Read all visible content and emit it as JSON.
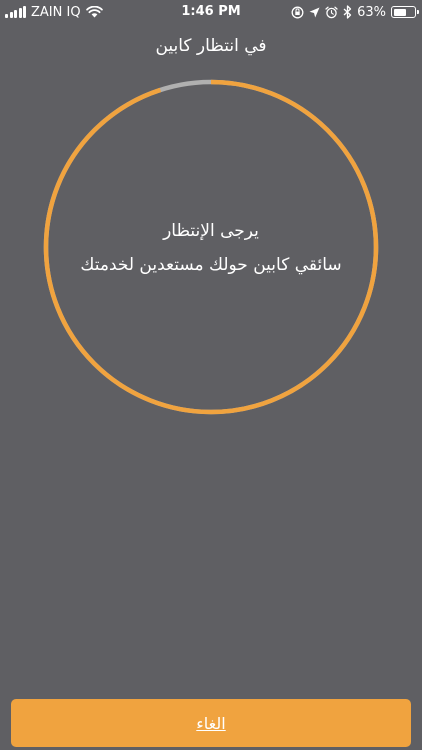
{
  "status_bar": {
    "carrier": "ZAIN IQ",
    "time": "1:46 PM",
    "battery_percent": "63%",
    "battery_level": 0.63
  },
  "header": {
    "title": "في انتظار كابين"
  },
  "waiting": {
    "title": "يرجى الإنتظار",
    "message": "سائقي كابين حولك مستعدين لخدمتك",
    "progress": 0.95
  },
  "footer": {
    "cancel_label": "الغاء"
  },
  "colors": {
    "background": "#5f5f63",
    "accent": "#f0a33f",
    "track": "#b0b0b0"
  },
  "icons": [
    "signal-icon",
    "wifi-icon",
    "location-lock-icon",
    "location-arrow-icon",
    "alarm-icon",
    "bluetooth-icon",
    "battery-icon"
  ]
}
